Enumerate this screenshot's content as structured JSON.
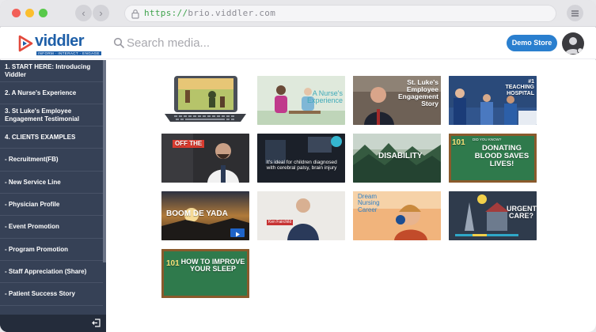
{
  "browser": {
    "url_protocol": "https://",
    "url_host": "brio.viddler.com"
  },
  "header": {
    "logo_text": "viddler",
    "logo_tagline": "INFORM · INTERACT · ENGAGE",
    "search_placeholder": "Search media...",
    "store_button": "Demo Store"
  },
  "sidebar": {
    "items": [
      {
        "label": "1. START HERE: Introducing Viddler"
      },
      {
        "label": "2. A Nurse's Experience"
      },
      {
        "label": "3. St Luke's Employee Engagement Testimonial"
      },
      {
        "label": "4. CLIENTS EXAMPLES"
      },
      {
        "label": "- Recruitment(FB)"
      },
      {
        "label": "- New Service Line"
      },
      {
        "label": "- Physician Profile"
      },
      {
        "label": "- Event Promotion"
      },
      {
        "label": "- Program Promotion"
      },
      {
        "label": "- Staff Appreciation (Share)"
      },
      {
        "label": "- Patient Success Story"
      }
    ]
  },
  "thumbnails": {
    "t2_title": "A Nurse's Experience",
    "t3_title": "St. Luke's Employee Engagement Story",
    "t4_title": "#1 TEACHING HOSPITAL",
    "t5_title": "OFF THE",
    "t6_caption": "It's ideal for children diagnosed with cerebral palsy, brain injury",
    "t7_title": "DISABILITY",
    "t8_topline": "DID YOU KNOW?",
    "t8_badge": "101",
    "t8_title": "DONATING BLOOD SAVES LIVES!",
    "t9_title": "BOOM DE YADA",
    "t10_name": "Ken Fairchild",
    "t11_title": "Dream Nursing Career",
    "t12_title": "URGENT CARE?",
    "t13_badge": "101",
    "t13_title": "HOW TO IMPROVE YOUR SLEEP"
  },
  "colors": {
    "sidebar_bg": "#364156",
    "accent": "#2a7fcf",
    "brand": "#1e5fa8"
  }
}
